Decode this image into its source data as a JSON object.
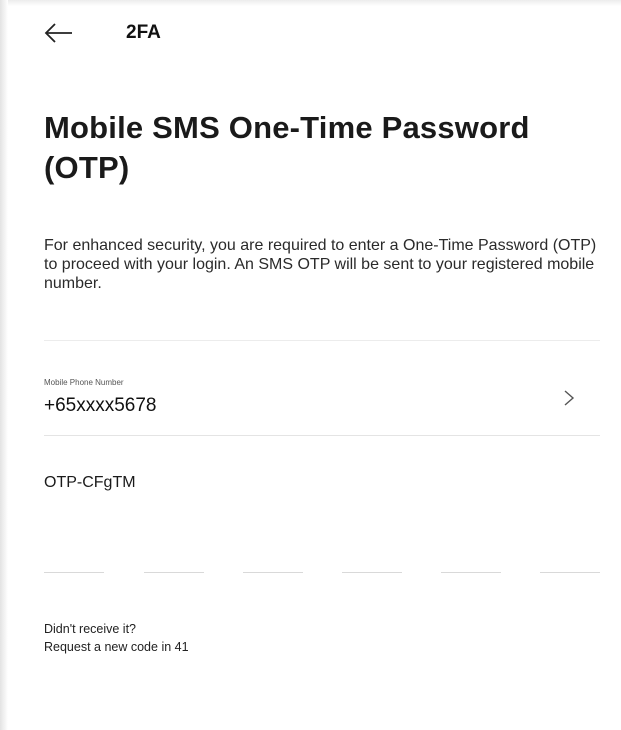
{
  "header": {
    "title": "2FA",
    "back_icon": "arrow-left-icon"
  },
  "main": {
    "title": "Mobile SMS One-Time Password (OTP)",
    "description": "For enhanced security, you are required to enter a One-Time Password (OTP) to proceed with your login. An SMS OTP will be sent to your registered mobile number.",
    "phone": {
      "label": "Mobile Phone Number",
      "value": "+65xxxx5678",
      "chevron_icon": "chevron-right-icon"
    },
    "otp": {
      "prefix": "OTP-CFgTM",
      "digits": [
        "",
        "",
        "",
        "",
        "",
        ""
      ]
    },
    "resend": {
      "line1": "Didn't receive it?",
      "line2": "Request a new code in 41"
    }
  }
}
